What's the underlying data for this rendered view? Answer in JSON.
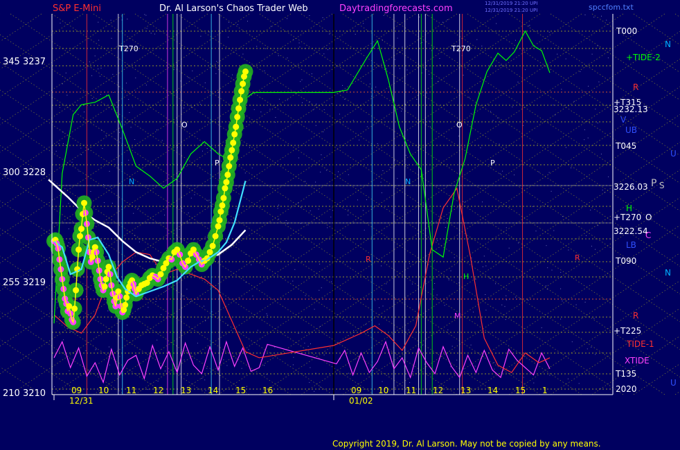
{
  "header": {
    "instrument": "S&P E-Mini",
    "title": "Dr. Al Larson's Chaos Trader Web",
    "site": "Daytradingforecasts.com",
    "timestamp_1": "12/31/2019 21:20 UPI",
    "timestamp_2": "12/31/2019 21:20 UPI",
    "file": "spccfom.txt"
  },
  "y_axis": {
    "labels": [
      {
        "text": "345  3237",
        "value": 3237
      },
      {
        "text": "300  3228",
        "value": 3228
      },
      {
        "text": "255  3219",
        "value": 3219
      },
      {
        "text": "210  3210",
        "value": 3210
      }
    ]
  },
  "x_axis": {
    "hours": [
      "09",
      "10",
      "11",
      "12",
      "13",
      "14",
      "15",
      "16",
      "09",
      "10",
      "11",
      "12",
      "13",
      "14",
      "15",
      "1"
    ],
    "dates": [
      "12/31",
      "01/02"
    ]
  },
  "right_labels": [
    {
      "text": "T000",
      "color": "#ffffff"
    },
    {
      "text": "+TIDE-2",
      "color": "#00ff00"
    },
    {
      "text": "R",
      "color": "#ff3030"
    },
    {
      "text": "+T315",
      "color": "#ffffff"
    },
    {
      "text": "3232.13",
      "color": "#ffffff"
    },
    {
      "text": "V",
      "color": "#3050ff"
    },
    {
      "text": "UB",
      "color": "#3050ff"
    },
    {
      "text": "T045",
      "color": "#ffffff"
    },
    {
      "text": "3226.03",
      "color": "#ffffff"
    },
    {
      "text": "H",
      "color": "#00ff00"
    },
    {
      "text": "+T270",
      "color": "#ffffff"
    },
    {
      "text": "3222.54",
      "color": "#ffffff"
    },
    {
      "text": "LB",
      "color": "#3050ff"
    },
    {
      "text": "T090",
      "color": "#ffffff"
    },
    {
      "text": "R",
      "color": "#ff3030"
    },
    {
      "text": "+T225",
      "color": "#ffffff"
    },
    {
      "text": "TIDE-1",
      "color": "#ff3030"
    },
    {
      "text": "XTIDE",
      "color": "#ff40ff"
    },
    {
      "text": "T135",
      "color": "#ffffff"
    },
    {
      "text": "2020",
      "color": "#ffffff"
    }
  ],
  "far_right_labels": [
    {
      "text": "N",
      "color": "#00b0ff"
    },
    {
      "text": "U",
      "color": "#3050ff"
    },
    {
      "text": "P",
      "color": "#c0c0c0"
    },
    {
      "text": "S",
      "color": "#c0c0c0"
    },
    {
      "text": "O",
      "color": "#ffffff"
    },
    {
      "text": "C",
      "color": "#ff40ff"
    },
    {
      "text": "N",
      "color": "#00b0ff"
    },
    {
      "text": "U",
      "color": "#3050ff"
    }
  ],
  "plot_annotations": [
    {
      "text": "T270",
      "color": "#ffffff"
    },
    {
      "text": "T270",
      "color": "#ffffff"
    },
    {
      "text": "O",
      "color": "#ffffff"
    },
    {
      "text": "O",
      "color": "#ffffff"
    },
    {
      "text": "P",
      "color": "#ffffff"
    },
    {
      "text": "P",
      "color": "#ffffff"
    },
    {
      "text": "N",
      "color": "#00b0ff"
    },
    {
      "text": "N",
      "color": "#00b0ff"
    },
    {
      "text": "H",
      "color": "#00ff00"
    },
    {
      "text": "M",
      "color": "#ff40ff"
    },
    {
      "text": "R",
      "color": "#ff3030"
    },
    {
      "text": "R",
      "color": "#ff3030"
    }
  ],
  "copyright": "Copyright 2019, Dr. Al Larson. May not be copied by any means.",
  "colors": {
    "background": "#000060",
    "price": "#ffff00",
    "tide2": "#00ff00",
    "tide1": "#ff3030",
    "xtide": "#ff40ff",
    "ma_slow": "#ffffff",
    "ma_fast": "#40e0ff",
    "fib_grid": "#ffff00"
  },
  "chart_data": {
    "type": "line",
    "y_range": [
      3210,
      3241
    ],
    "price": {
      "x": [
        0,
        0.05,
        0.1,
        0.15,
        0.2,
        0.25,
        0.3,
        0.35,
        0.4,
        0.45,
        0.5,
        0.55,
        0.6,
        0.65,
        0.7,
        0.75,
        0.8,
        0.85,
        0.9,
        0.95,
        1.0,
        1.05,
        1.1,
        1.15,
        1.2,
        1.25,
        1.3,
        1.35,
        1.4,
        1.45,
        1.5,
        1.55,
        1.6,
        1.65,
        1.7,
        1.75,
        1.8,
        1.85,
        1.9,
        1.95,
        2.0,
        2.05,
        2.1,
        2.15,
        2.2,
        2.25,
        2.3,
        2.35,
        2.4,
        2.45,
        2.5,
        2.55,
        2.6,
        2.65,
        2.7,
        2.75,
        2.8,
        2.85,
        2.9,
        2.95,
        3.0,
        3.1,
        3.2,
        3.3,
        3.4,
        3.5,
        3.6,
        3.7,
        3.8,
        3.9,
        4.0,
        4.1,
        4.2,
        4.3,
        4.4,
        4.5,
        4.6,
        4.7,
        4.8,
        4.9,
        5.0,
        5.1,
        5.2,
        5.3,
        5.4,
        5.5,
        5.6,
        5.7,
        5.8,
        5.9,
        6.0,
        6.05,
        6.1,
        6.15,
        6.2,
        6.25,
        6.3,
        6.35,
        6.4,
        6.45,
        6.5,
        6.55,
        6.6,
        6.65,
        6.7,
        6.75,
        6.8,
        6.85,
        6.9,
        6.95,
        7.0
      ],
      "y": [
        3222.5,
        3222.6,
        3222.3,
        3221.9,
        3221.0,
        3220.2,
        3219.4,
        3218.6,
        3217.8,
        3217.4,
        3216.8,
        3217.2,
        3216.6,
        3216.1,
        3215.9,
        3217.0,
        3218.5,
        3220.2,
        3221.8,
        3222.9,
        3223.5,
        3224.7,
        3225.6,
        3224.8,
        3223.9,
        3222.8,
        3221.6,
        3220.8,
        3221.2,
        3221.6,
        3222.0,
        3221.6,
        3220.9,
        3220.1,
        3219.4,
        3218.9,
        3218.5,
        3218.8,
        3219.4,
        3220.0,
        3220.4,
        3219.8,
        3218.9,
        3218.2,
        3217.6,
        3217.2,
        3217.9,
        3218.4,
        3218.0,
        3217.2,
        3216.7,
        3216.9,
        3217.3,
        3217.9,
        3218.4,
        3218.8,
        3219.1,
        3219.3,
        3219.0,
        3218.6,
        3218.2,
        3218.6,
        3218.9,
        3219.0,
        3219.1,
        3219.5,
        3219.7,
        3219.6,
        3219.4,
        3219.8,
        3220.3,
        3220.7,
        3221.1,
        3221.0,
        3221.6,
        3221.8,
        3221.4,
        3220.7,
        3220.4,
        3220.9,
        3221.5,
        3221.8,
        3221.4,
        3221.0,
        3220.6,
        3220.9,
        3221.1,
        3221.6,
        3222.1,
        3222.9,
        3223.7,
        3224.2,
        3224.9,
        3225.4,
        3226.0,
        3226.8,
        3227.3,
        3227.9,
        3228.6,
        3229.3,
        3229.9,
        3230.5,
        3231.2,
        3231.8,
        3232.6,
        3233.3,
        3234.0,
        3234.7,
        3235.3,
        3235.9,
        3236.3
      ]
    },
    "ma_slow": {
      "x": [
        -0.2,
        0,
        0.5,
        1,
        1.5,
        2,
        2.5,
        3,
        3.5,
        4,
        4.5,
        5,
        5.5,
        6,
        6.5,
        7
      ],
      "y": [
        3227.5,
        3227.1,
        3226.1,
        3225.0,
        3224.2,
        3223.6,
        3222.5,
        3221.6,
        3221.1,
        3220.8,
        3220.6,
        3220.7,
        3221.0,
        3221.4,
        3222.2,
        3223.4
      ]
    },
    "ma_fast": {
      "x": [
        0,
        0.3,
        0.6,
        1.0,
        1.3,
        1.6,
        2.0,
        2.3,
        2.6,
        3.0,
        3.5,
        4.0,
        4.5,
        5.0,
        5.3,
        5.6,
        6.0,
        6.3,
        6.6,
        7.0
      ],
      "y": [
        3222.5,
        3222.0,
        3219.8,
        3220.2,
        3222.6,
        3222.8,
        3221.4,
        3219.6,
        3218.6,
        3218.0,
        3218.4,
        3218.8,
        3219.3,
        3220.4,
        3220.8,
        3221.0,
        3221.6,
        3222.4,
        3224.0,
        3227.4
      ]
    },
    "tide2": {
      "x": [
        0,
        0.3,
        0.7,
        1.0,
        1.5,
        2.0,
        2.5,
        3.0,
        3.5,
        4.0,
        4.5,
        5.0,
        5.5,
        6.0,
        6.5,
        7.0,
        7.3,
        8.0,
        8.5,
        9.2,
        9.6,
        10.0,
        10.4,
        10.8,
        11.2,
        11.6,
        12.0,
        12.4,
        12.8,
        13.2,
        13.6,
        14.0,
        14.3,
        14.6,
        15.0,
        15.3,
        15.6,
        15.9
      ],
      "y": [
        3215.8,
        3228.0,
        3232.8,
        3233.6,
        3233.8,
        3234.4,
        3231.6,
        3228.6,
        3227.8,
        3226.8,
        3227.6,
        3229.6,
        3230.6,
        3229.6,
        3229.0,
        3234.1,
        3234.6,
        3234.6,
        3234.8,
        3237.4,
        3238.8,
        3235.6,
        3231.8,
        3229.6,
        3228.3,
        3221.8,
        3221.2,
        3226.4,
        3229.2,
        3233.6,
        3236.3,
        3237.8,
        3237.2,
        3237.9,
        3239.6,
        3238.4,
        3238.0,
        3236.2
      ]
    },
    "tide1": {
      "x": [
        0,
        0.5,
        1.0,
        1.5,
        2.0,
        2.5,
        3.0,
        3.5,
        4.0,
        4.5,
        5.0,
        5.5,
        6.0,
        6.5,
        7.0,
        7.5,
        8.0,
        8.5,
        9.0,
        9.5,
        10.0,
        10.5,
        11.0,
        11.5,
        12.0,
        12.5,
        13.0,
        13.5,
        14.0,
        14.5,
        15.0,
        15.5,
        15.9
      ],
      "y": [
        3216.5,
        3215.5,
        3215.0,
        3216.5,
        3219.5,
        3220.8,
        3221.6,
        3221.4,
        3219.8,
        3220.2,
        3219.8,
        3219.4,
        3218.5,
        3216.0,
        3213.5,
        3213.0,
        3214.0,
        3214.5,
        3215.0,
        3215.6,
        3214.8,
        3213.6,
        3215.6,
        3221.4,
        3225.2,
        3226.8,
        3221.2,
        3214.6,
        3212.4,
        3211.8,
        3213.4,
        3212.6,
        3213.0
      ]
    },
    "xtide": {
      "x": [
        0,
        0.3,
        0.6,
        0.9,
        1.2,
        1.5,
        1.8,
        2.1,
        2.4,
        2.7,
        3.0,
        3.3,
        3.6,
        3.9,
        4.2,
        4.5,
        4.8,
        5.1,
        5.4,
        5.7,
        6.0,
        6.3,
        6.6,
        6.9,
        7.2,
        7.5,
        7.8,
        8.1,
        8.4,
        8.7,
        9.0,
        9.3,
        9.6,
        9.9,
        10.2,
        10.5,
        10.8,
        11.1,
        11.4,
        11.7,
        12.0,
        12.3,
        12.6,
        12.9,
        13.2,
        13.5,
        13.8,
        14.1,
        14.4,
        14.7,
        15.0,
        15.3,
        15.6,
        15.9
      ],
      "y": [
        3213.0,
        3214.3,
        3212.2,
        3213.8,
        3211.5,
        3212.6,
        3211.0,
        3213.7,
        3211.6,
        3212.8,
        3213.2,
        3211.3,
        3214.0,
        3212.1,
        3213.5,
        3211.8,
        3214.2,
        3212.4,
        3211.7,
        3213.9,
        3212.0,
        3214.3,
        3212.3,
        3213.8,
        3211.9,
        3212.2,
        3214.1,
        3212.5,
        3213.6,
        3211.6,
        3213.4,
        3211.8,
        3212.7,
        3214.3,
        3212.1,
        3213.0,
        3211.4,
        3213.8,
        3212.6,
        3211.7,
        3213.9,
        3212.3,
        3211.4,
        3213.2,
        3211.8,
        3213.6,
        3212.0,
        3211.4,
        3213.7,
        3212.8,
        3212.2,
        3211.6,
        3213.4,
        3212.1
      ]
    },
    "sessions": [
      {
        "date": "12/31",
        "hours": [
          "09",
          "10",
          "11",
          "12",
          "13",
          "14",
          "15",
          "16"
        ]
      },
      {
        "date": "01/02",
        "hours": [
          "09",
          "10",
          "11",
          "12",
          "13",
          "14",
          "15",
          "1"
        ]
      }
    ]
  }
}
